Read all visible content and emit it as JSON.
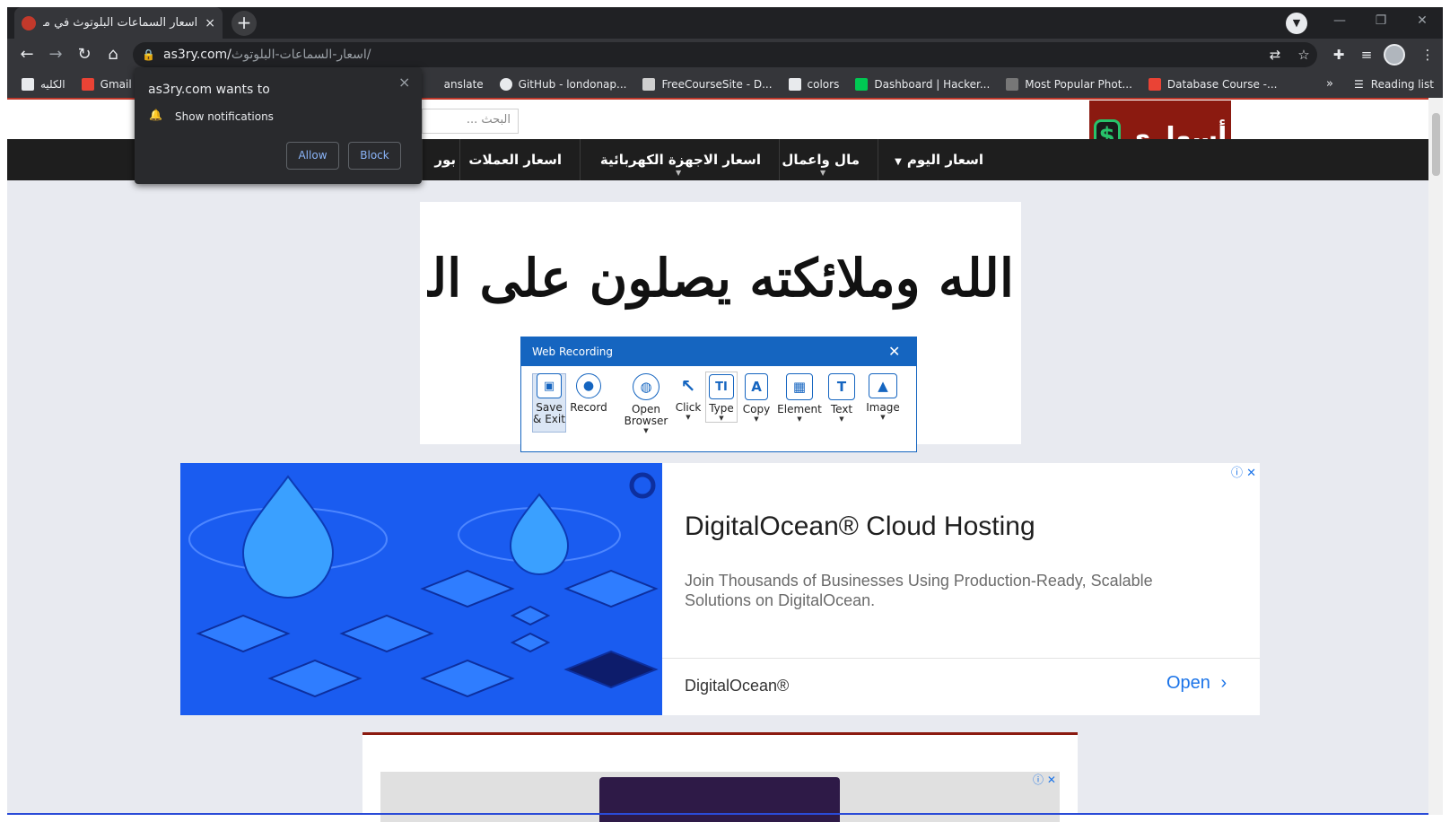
{
  "browser": {
    "tab_title": "اسعار السماعات البلوتوث في مصر",
    "tab_close": "×",
    "new_tab": "+",
    "window_buttons": [
      "—",
      "❐",
      "✕"
    ],
    "url_host": "as3ry.com/",
    "url_path": "اسعار-السماعات-البلوتوث/",
    "bookmarks": [
      {
        "label": "الكليه",
        "color": "#e8eaed"
      },
      {
        "label": "Gmail",
        "color": "#ea4335"
      },
      {
        "label": "anslate",
        "color": "#35363a"
      },
      {
        "label": "GitHub - londonap...",
        "color": "#e8eaed"
      },
      {
        "label": "FreeCourseSite - D...",
        "color": "#cfcfcf"
      },
      {
        "label": "colors",
        "color": "#e8eaed"
      },
      {
        "label": "Dashboard | Hacker...",
        "color": "#00c853"
      },
      {
        "label": "Most Popular Phot...",
        "color": "#777777"
      },
      {
        "label": "Database Course -...",
        "color": "#ea4335"
      }
    ],
    "bookmarks_more": "»",
    "reading_list": "Reading list"
  },
  "notification": {
    "title": "as3ry.com wants to",
    "text": "Show notifications",
    "allow": "Allow",
    "block": "Block",
    "close": "×"
  },
  "site": {
    "search_placeholder": "البحث ...",
    "logo_text": "أسعاري",
    "logo_symbol": "$",
    "nav": [
      "اسعار اليوم",
      "مال واعمال",
      "اسعار الاجهزة الكهربائية",
      "اسعار العملات",
      "بور"
    ],
    "banner_text": "إن الله وملائكته يصلون على النبي"
  },
  "web_recording": {
    "title": "Web Recording",
    "close": "✕",
    "tools": [
      {
        "label": "Save & Exit",
        "icon": "save-icon",
        "glyph": "💾"
      },
      {
        "label": "Record",
        "icon": "record-icon",
        "glyph": "●"
      },
      {
        "label": "Open Browser",
        "icon": "globe-icon",
        "glyph": "🌐"
      },
      {
        "label": "Click",
        "icon": "cursor-icon",
        "glyph": "↖"
      },
      {
        "label": "Type",
        "icon": "type-icon",
        "glyph": "TI"
      },
      {
        "label": "Copy",
        "icon": "copy-icon",
        "glyph": "A"
      },
      {
        "label": "Element",
        "icon": "element-icon",
        "glyph": "▦"
      },
      {
        "label": "Text",
        "icon": "text-icon",
        "glyph": "T"
      },
      {
        "label": "Image",
        "icon": "image-icon",
        "glyph": "▲"
      }
    ]
  },
  "ad": {
    "title": "DigitalOcean® Cloud Hosting",
    "description": "Join Thousands of Businesses Using Production-Ready, Scalable Solutions on DigitalOcean.",
    "brand": "DigitalOcean®",
    "cta": "Open",
    "cta_arrow": "›",
    "choices": "ⓘ ✕",
    "accent": "#1a73e8"
  },
  "card_ad": {
    "choices": "ⓘ ✕"
  }
}
